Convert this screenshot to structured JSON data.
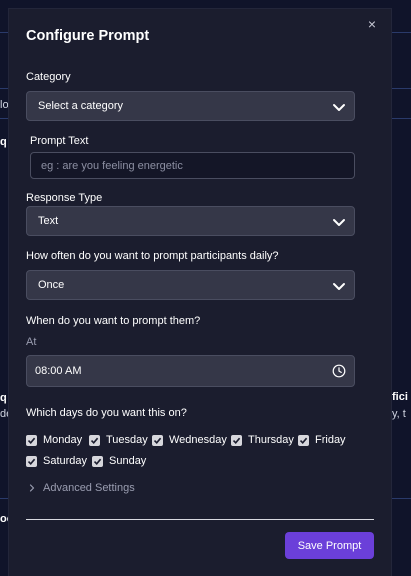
{
  "background": {
    "fragments": [
      "lo-",
      "q",
      "q",
      "fici",
      "de",
      "y, t",
      "oo"
    ]
  },
  "modal": {
    "title": "Configure Prompt",
    "close_glyph": "×",
    "category": {
      "label": "Category",
      "value": "Select a category"
    },
    "prompt_text": {
      "label": "Prompt Text",
      "placeholder": "eg : are you feeling energetic"
    },
    "response_type": {
      "label": "Response Type",
      "value": "Text"
    },
    "frequency": {
      "label": "How often do you want to prompt participants daily?",
      "value": "Once"
    },
    "timing": {
      "label": "When do you want to prompt them?",
      "at_label": "At",
      "time": "08:00 AM"
    },
    "days": {
      "label": "Which days do you want this on?",
      "items": [
        {
          "label": "Monday",
          "checked": true
        },
        {
          "label": "Tuesday",
          "checked": true
        },
        {
          "label": "Wednesday",
          "checked": true
        },
        {
          "label": "Thursday",
          "checked": true
        },
        {
          "label": "Friday",
          "checked": true
        },
        {
          "label": "Saturday",
          "checked": true
        },
        {
          "label": "Sunday",
          "checked": true
        }
      ]
    },
    "advanced_settings": "Advanced Settings",
    "save_button": "Save Prompt"
  },
  "colors": {
    "accent": "#6b3fd9",
    "modal_bg": "#1b1d2e",
    "field_bg": "#353748",
    "page_bg": "#10142a"
  },
  "icons": [
    "close-icon",
    "chevron-down-icon",
    "clock-icon",
    "check-icon",
    "chevron-right-icon"
  ]
}
